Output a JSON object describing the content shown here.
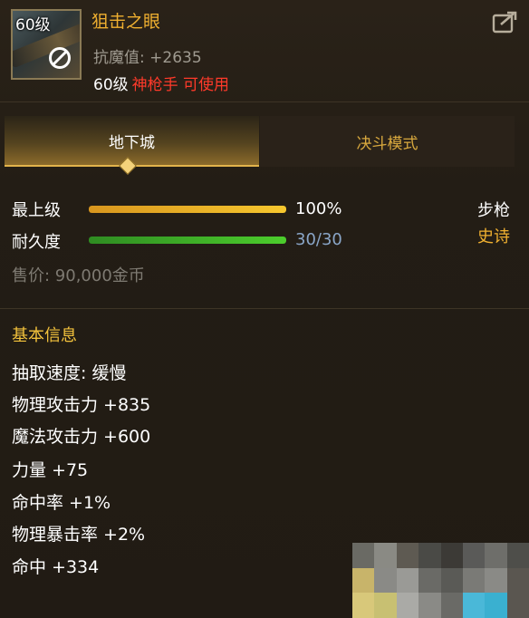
{
  "item": {
    "level_badge": "60级",
    "name": "狙击之眼",
    "stat_line": "抗魔值: +2635",
    "required_level": "60级",
    "required_class": "神枪手 可使用"
  },
  "tabs": {
    "active": "地下城",
    "other": "决斗模式"
  },
  "upgrade": {
    "label": "最上级",
    "value_text": "100%",
    "fill_fraction": 1.0,
    "color": "#f0b82a"
  },
  "durability": {
    "label": "耐久度",
    "value_text": "30/30",
    "fill_fraction": 1.0,
    "color": "#3fb52a",
    "value_color": "#8aa6c8"
  },
  "weapon_type": "步枪",
  "rarity": "史诗",
  "rarity_color": "#f0b030",
  "sell_price": "售价: 90,000金币",
  "basic_info": {
    "title": "基本信息",
    "attributes": [
      "抽取速度: 缓慢",
      "物理攻击力 +835",
      "魔法攻击力 +600",
      "力量 +75",
      "命中率 +1%",
      "物理暴击率 +2%",
      "命中 +334"
    ]
  },
  "icons": {
    "ban": "no-entry-icon",
    "share": "share-icon"
  }
}
